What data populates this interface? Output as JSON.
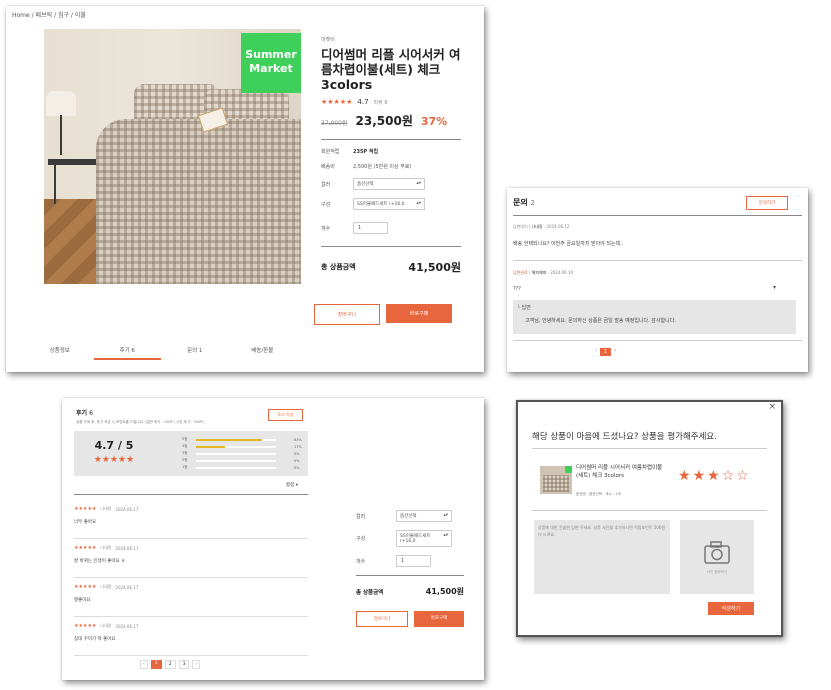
{
  "product_panel": {
    "breadcrumb": "Home / 패브릭 / 침구 / 이불",
    "badge_line1": "Summer",
    "badge_line2": "Market",
    "brand": "마켓비",
    "title": "디어썸머 리플 시어서커 여름차렵이불(세트) 체크 3colors",
    "rating_stars": "★★★★★",
    "rating_value": "4.7",
    "review_count": "리뷰 6",
    "original_price": "37,000원",
    "sale_price": "23,500원",
    "discount": "37%",
    "points_label": "회원적립",
    "points_value": "235P 적립",
    "shipping_label": "배송비",
    "shipping_value": "2,500원 (5만원 이상 무료)",
    "color_label": "컬러",
    "color_value": "옵션선택",
    "config_label": "구성",
    "config_value": "SS이불패드세트 (+16,0",
    "qty_label": "개수",
    "qty_value": "1",
    "total_label": "총 상품금액",
    "total_value": "41,500원",
    "cart_button": "장바구니",
    "buy_button": "바로구매",
    "tabs": [
      {
        "label": "상품정보"
      },
      {
        "label": "후기 6"
      },
      {
        "label": "문의 1"
      },
      {
        "label": "배송/환불"
      }
    ]
  },
  "qna_panel": {
    "title": "문의",
    "count": "2",
    "write_button": "문의하기",
    "items": [
      {
        "status": "답변대기",
        "author": "나내랑",
        "date": "2024.06.12",
        "body": "배송 언제되나요? 이번주 금요일까지 받아야 되는데.."
      },
      {
        "status": "답변완료",
        "author": "해피해피",
        "date": "2024.06.10",
        "body": "???"
      }
    ],
    "answer_label": "└ 답변",
    "answer_text": "고객님, 안녕하세요. 문의하신 상품은 금일 발송 예정입니다. 감사합니다.",
    "pages": [
      "‹",
      "1",
      "›"
    ]
  },
  "review_panel": {
    "title": "후기",
    "count": "6",
    "write_button": "후기 작성",
    "notice": "상품 구매 후, 후기 작성 시 포인트를 드립니다. (일반 후기 : 100P / 사진 후기 : 500P)",
    "avg": "4.7 / 5",
    "avg_stars": "★★★★★",
    "bars": [
      {
        "label": "5점",
        "fill": 0.83,
        "pct": "83%"
      },
      {
        "label": "4점",
        "fill": 0.36,
        "pct": "17%"
      },
      {
        "label": "3점",
        "fill": 0,
        "pct": "0%"
      },
      {
        "label": "2점",
        "fill": 0,
        "pct": "0%"
      },
      {
        "label": "1점",
        "fill": 0,
        "pct": "0%"
      }
    ],
    "sort": "평점 ▾",
    "reviews": [
      {
        "stars": "★★★★★",
        "author": "나내랑",
        "date": "2024.06.17",
        "body": "너무 좋아요"
      },
      {
        "stars": "★★★★★",
        "author": "나내랑",
        "date": "2024.06.17",
        "body": "잘 바뀌는 인생이 좋아요 ㅎ"
      },
      {
        "stars": "★★★★★",
        "author": "나내랑",
        "date": "2024.06.17",
        "body": "짱좋아요"
      },
      {
        "stars": "★★★★★",
        "author": "나내랑",
        "date": "2024.06.17",
        "body": "침대 꾸미기 딱 좋아요"
      }
    ],
    "pages": [
      "‹",
      "1",
      "2",
      "3",
      "›"
    ],
    "side": {
      "color_label": "컬러",
      "color_value": "옵션선택",
      "config_label": "구성",
      "config_value": "SS이불패드세트 (+16,0",
      "qty_label": "개수",
      "qty_value": "1",
      "total_label": "총 상품금액",
      "total_value": "41,500원",
      "cart_button": "장바구니",
      "buy_button": "바로구매"
    }
  },
  "rate_modal": {
    "close": "×",
    "heading": "해당 상품이 마음에 드셨나요? 상품을 평가해주세요.",
    "product_name": "디어썸머 리플 시어서커 여름차렵이불(세트) 체크 3colors",
    "product_option": "옵션명 : 옵션선택 · 개수 : 1개",
    "rating": 3,
    "max_rating": 5,
    "textarea_placeholder": "상품에 대한 진솔한 답변 주세요. 상품 사진을 추가하시면 적립포인트 500원 더 드려요.",
    "photo_label": "사진 첨부하기",
    "submit_button": "작성하기"
  },
  "colors": {
    "accent": "#e8663d",
    "badge": "#3ed05b"
  }
}
